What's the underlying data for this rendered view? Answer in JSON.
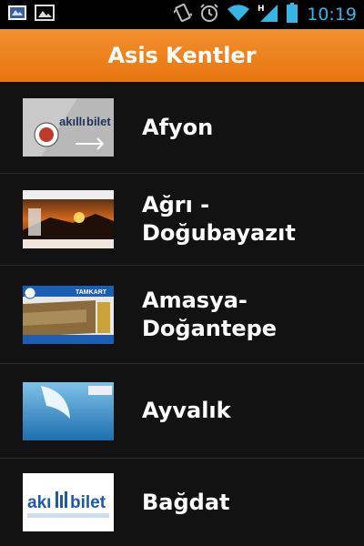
{
  "status_bar": {
    "time": "10:19",
    "icons": [
      "app-notification-icon",
      "image-notification-icon",
      "vibrate-icon",
      "alarm-icon",
      "wifi-icon",
      "signal-h-icon",
      "battery-icon"
    ],
    "signal_type": "H",
    "accent_color": "#34b6e6"
  },
  "action_bar": {
    "title": "Asis Kentler",
    "color": "#ec8120"
  },
  "cities": [
    {
      "name": "Afyon",
      "card": "akilli-bilet-gray-card",
      "card_text": "akıllıbilet"
    },
    {
      "name": "Ağrı - Doğubayazıt",
      "card": "dogubayazit-sunset-card"
    },
    {
      "name": "Amasya-\nDoğantepe",
      "card": "tamkart-card",
      "card_text": "TAMKART"
    },
    {
      "name": "Ayvalık",
      "card": "ayvalik-sea-card"
    },
    {
      "name": "Bağdat",
      "card": "akilli-bilet-white-card",
      "card_text": "akıllıbilet"
    }
  ]
}
